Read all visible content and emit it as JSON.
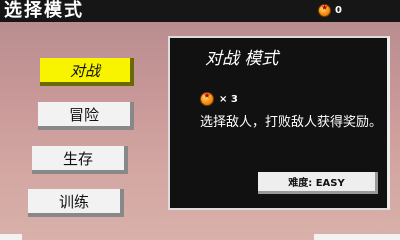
{
  "header": {
    "title": "选择模式",
    "coin_count": "0"
  },
  "modes": [
    {
      "label": "对战",
      "active": true
    },
    {
      "label": "冒险",
      "active": false
    },
    {
      "label": "生存",
      "active": false
    },
    {
      "label": "训练",
      "active": false
    }
  ],
  "panel": {
    "title": "对战 模式",
    "reward_count": "× 3",
    "description": "选择敌人，打败敌人获得奖励。",
    "difficulty": "难度: EASY"
  },
  "colors": {
    "accent": "#f8f400",
    "panel_bg": "#111111",
    "orb": "#ff9a1a"
  },
  "icons": {
    "coin": "dragon-ball-icon",
    "reward": "dragon-ball-icon"
  }
}
